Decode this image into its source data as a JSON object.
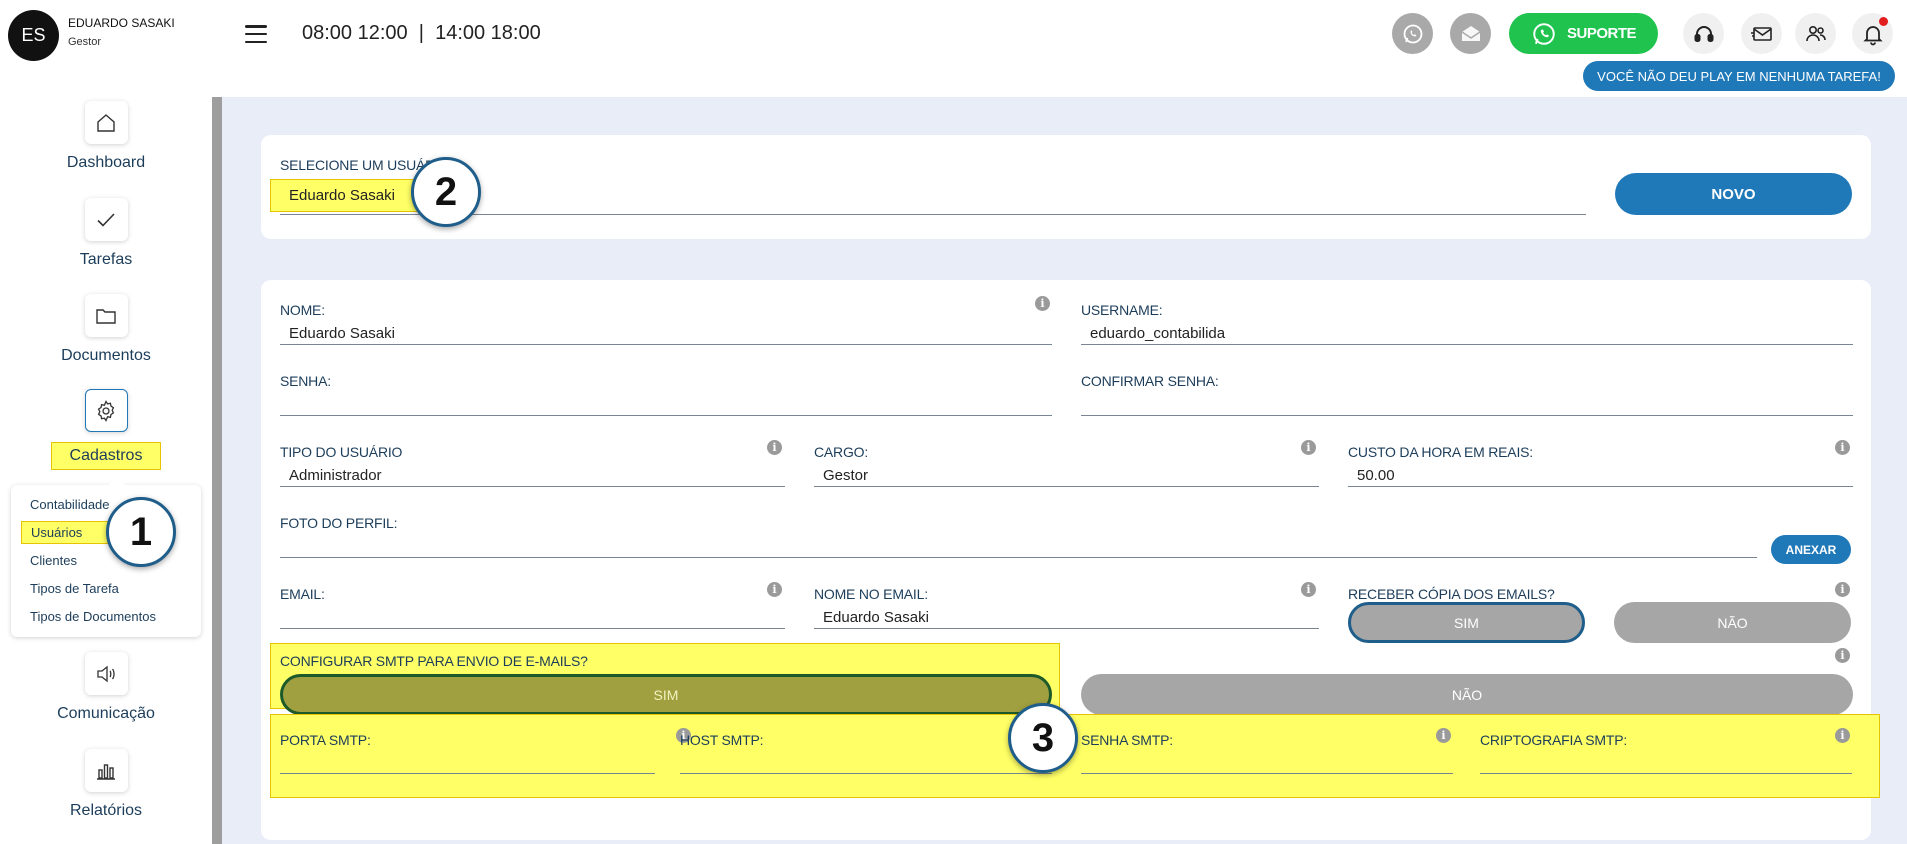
{
  "user": {
    "initials": "ES",
    "name": "EDUARDO SASAKI",
    "role": "Gestor"
  },
  "header": {
    "hours": "08:00 12:00  |  14:00 18:00",
    "support_label": "SUPORTE",
    "play_badge": "VOCÊ NÃO DEU PLAY EM NENHUMA TAREFA!"
  },
  "sidebar": {
    "items": [
      {
        "label": "Dashboard",
        "icon": "home-icon"
      },
      {
        "label": "Tarefas",
        "icon": "check-icon"
      },
      {
        "label": "Documentos",
        "icon": "folder-icon"
      },
      {
        "label": "Cadastros",
        "icon": "gear-icon"
      },
      {
        "label": "Comunicação",
        "icon": "speaker-icon"
      },
      {
        "label": "Relatórios",
        "icon": "bar-chart-icon"
      }
    ],
    "submenu": [
      "Contabilidade",
      "Usuários",
      "Clientes",
      "Tipos de Tarefa",
      "Tipos de Documentos"
    ]
  },
  "select_user": {
    "label": "SELECIONE UM USUÁRIO",
    "value": "Eduardo Sasaki",
    "new_button": "NOVO"
  },
  "form": {
    "nome_label": "NOME:",
    "nome_value": "Eduardo Sasaki",
    "username_label": "USERNAME:",
    "username_value": "eduardo_contabilida",
    "senha_label": "SENHA:",
    "confirmar_label": "CONFIRMAR SENHA:",
    "tipo_label": "TIPO DO USUÁRIO",
    "tipo_value": "Administrador",
    "cargo_label": "CARGO:",
    "cargo_value": "Gestor",
    "custo_label": "CUSTO DA HORA EM REAIS:",
    "custo_value": "50.00",
    "foto_label": "FOTO DO PERFIL:",
    "anexar_button": "ANEXAR",
    "email_label": "EMAIL:",
    "nome_email_label": "NOME NO EMAIL:",
    "nome_email_value": "Eduardo Sasaki",
    "receber_label": "RECEBER CÓPIA DOS EMAILS?",
    "receber_sim": "SIM",
    "receber_nao": "NÃO",
    "smtp_label": "CONFIGURAR SMTP PARA ENVIO DE E-MAILS?",
    "smtp_sim": "SIM",
    "smtp_nao": "NÃO",
    "porta_label": "PORTA SMTP:",
    "host_label": "HOST SMTP:",
    "senha_smtp_label": "SENHA SMTP:",
    "cripto_label": "CRIPTOGRAFIA SMTP:"
  },
  "markers": [
    "1",
    "2",
    "3"
  ],
  "colors": {
    "accent_blue": "#1f78b8",
    "whatsapp_green": "#1fc34e",
    "highlight_yellow": "#ffff66",
    "olive": "#a0a040"
  }
}
